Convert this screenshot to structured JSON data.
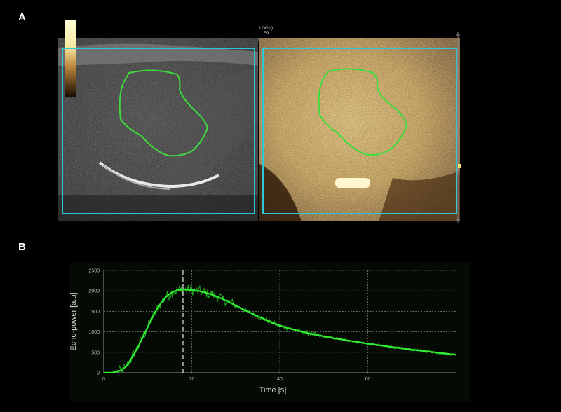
{
  "panel_labels": {
    "a": "A",
    "b": "B"
  },
  "device_label": {
    "line1": "LOGIQ",
    "line2": "E9"
  },
  "colors": {
    "roi_box": "#2fc6d8",
    "roi_contour": "#3ddc3d",
    "curve_fit": "#33ee33",
    "curve_raw": "#22aa22",
    "grid": "#9a9a9a"
  },
  "chart_data": {
    "type": "line",
    "xlabel": "Time [s]",
    "ylabel": "Echo-power [a.u]",
    "xlim": [
      0,
      80
    ],
    "ylim": [
      0,
      2500
    ],
    "x_ticks": [
      0,
      20,
      40,
      60
    ],
    "y_ticks": [
      0,
      500,
      1000,
      1500,
      2000,
      2500
    ],
    "peak_marker_x": 18,
    "grid": true,
    "series": [
      {
        "x": [
          0,
          2,
          4,
          5,
          6,
          7,
          8,
          9,
          10,
          11,
          12,
          13,
          14,
          15,
          16,
          17,
          18,
          19,
          20,
          22,
          24,
          26,
          28,
          30,
          32,
          35,
          38,
          40,
          44,
          48,
          52,
          56,
          60,
          64,
          68,
          72,
          76,
          80
        ],
        "values": [
          0,
          5,
          60,
          150,
          300,
          480,
          680,
          900,
          1120,
          1340,
          1540,
          1710,
          1840,
          1930,
          1990,
          2020,
          2030,
          2030,
          2020,
          1990,
          1930,
          1850,
          1750,
          1640,
          1530,
          1380,
          1240,
          1150,
          1030,
          930,
          850,
          780,
          710,
          650,
          590,
          540,
          490,
          440
        ]
      }
    ]
  }
}
